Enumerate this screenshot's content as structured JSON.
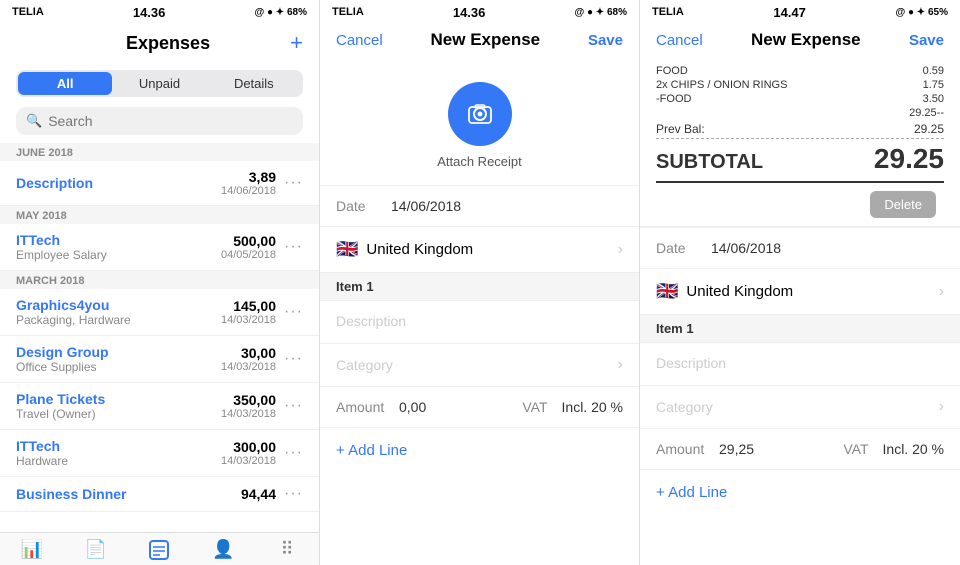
{
  "panels": [
    {
      "id": "expenses-list",
      "statusBar": {
        "carrier": "TELIA",
        "time": "14.36",
        "icons": "@ ● ✦ 68%"
      },
      "header": {
        "title": "Expenses",
        "addBtn": "+"
      },
      "segments": [
        {
          "label": "All",
          "active": true
        },
        {
          "label": "Unpaid",
          "active": false
        },
        {
          "label": "Details",
          "active": false
        }
      ],
      "search": {
        "placeholder": "Search"
      },
      "sections": [
        {
          "label": "JUNE 2018",
          "items": [
            {
              "title": "Description",
              "sub": "",
              "amount": "3,89",
              "date": "14/06/2018",
              "titleBlue": true
            }
          ]
        },
        {
          "label": "MAY 2018",
          "items": [
            {
              "title": "ITTech",
              "sub": "Employee Salary",
              "amount": "500,00",
              "date": "04/05/2018",
              "titleBlue": false
            }
          ]
        },
        {
          "label": "MARCH 2018",
          "items": [
            {
              "title": "Graphics4you",
              "sub": "Packaging, Hardware",
              "amount": "145,00",
              "date": "14/03/2018",
              "titleBlue": false
            },
            {
              "title": "Design Group",
              "sub": "Office Supplies",
              "amount": "30,00",
              "date": "14/03/2018",
              "titleBlue": false
            },
            {
              "title": "Plane Tickets",
              "sub": "Travel (Owner)",
              "amount": "350,00",
              "date": "14/03/2018",
              "titleBlue": false
            },
            {
              "title": "ITTech",
              "sub": "Hardware",
              "amount": "300,00",
              "date": "14/03/2018",
              "titleBlue": false
            },
            {
              "title": "Business Dinner",
              "sub": "",
              "amount": "94,44",
              "date": "",
              "titleBlue": false
            }
          ]
        }
      ],
      "tabs": [
        {
          "icon": "📈",
          "active": false
        },
        {
          "icon": "📄",
          "active": false
        },
        {
          "icon": "🗂",
          "active": true
        },
        {
          "icon": "👤",
          "active": false
        },
        {
          "icon": "⠿",
          "active": false
        }
      ]
    },
    {
      "id": "new-expense-empty",
      "statusBar": {
        "carrier": "TELIA",
        "time": "14.36",
        "icons": "@ ● ✦ 68%"
      },
      "header": {
        "cancel": "Cancel",
        "title": "New Expense",
        "save": "Save"
      },
      "attachReceipt": {
        "label": "Attach Receipt"
      },
      "date": {
        "label": "Date",
        "value": "14/06/2018"
      },
      "country": {
        "flag": "🇬🇧",
        "name": "United Kingdom"
      },
      "item1": {
        "sectionLabel": "Item 1",
        "descPlaceholder": "Description",
        "categoryPlaceholder": "Category",
        "amountLabel": "Amount",
        "amountValue": "0,00",
        "vatLabel": "VAT",
        "vatValue": "Incl. 20 %"
      },
      "addLine": "+ Add Line"
    },
    {
      "id": "new-expense-filled",
      "statusBar": {
        "carrier": "TELIA",
        "time": "14.47",
        "icons": "@ ● ✦ 65%"
      },
      "header": {
        "cancel": "Cancel",
        "title": "New Expense",
        "save": "Save"
      },
      "receiptLines": [
        {
          "desc": "FOOD",
          "amount": "0.59"
        },
        {
          "desc": "2x CHIPS / ONION RINGS",
          "amount": "1.75"
        },
        {
          "desc": "-FOOD",
          "amount": "3.50"
        },
        {
          "desc": "",
          "amount": "29.25--"
        }
      ],
      "prevBal": {
        "label": "Prev Bal:",
        "value": "29.25"
      },
      "subtotal": {
        "label": "SUBTOTAL",
        "value": "29.25"
      },
      "deleteBtn": "Delete",
      "date": {
        "label": "Date",
        "value": "14/06/2018"
      },
      "country": {
        "flag": "🇬🇧",
        "name": "United Kingdom"
      },
      "item1": {
        "sectionLabel": "Item 1",
        "descPlaceholder": "Description",
        "categoryPlaceholder": "Category",
        "amountLabel": "Amount",
        "amountValue": "29,25",
        "vatLabel": "VAT",
        "vatValue": "Incl. 20 %"
      },
      "addLine": "+ Add Line"
    }
  ]
}
